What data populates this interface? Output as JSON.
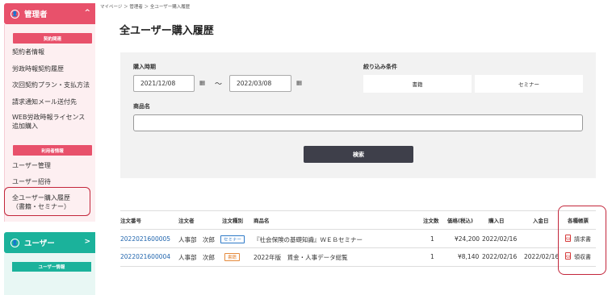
{
  "sidebar": {
    "admin": {
      "title": "管理者",
      "icon": "person-circle-icon",
      "chevron": "^",
      "categories": {
        "contract": "契約関連",
        "user_info": "利用者情報"
      },
      "contract_items": [
        "契約者情報",
        "労政時報契約履歴",
        "次回契約プラン・支払方法",
        "請求通知メール送付先",
        "WEB労政時報ライセンス",
        "追加購入"
      ],
      "user_items": [
        "ユーザー管理",
        "ユーザー招待"
      ],
      "active_item_line1": "全ユーザー購入履歴",
      "active_item_line2": "（書籍・セミナー）",
      "accent_color": "#e8516b"
    },
    "user": {
      "title": "ユーザー",
      "icon": "person-circle-icon",
      "chevron": ">",
      "category": "ユーザー情報",
      "accent_color": "#1bb29b"
    }
  },
  "breadcrumb": "マイページ ＞ 管理者 ＞ 全ユーザー購入履歴",
  "page_title": "全ユーザー購入履歴",
  "search": {
    "period_label": "購入時期",
    "date_from": "2021/12/08",
    "date_to": "2022/03/08",
    "tilde": "〜",
    "filter_label": "絞り込み条件",
    "filter_book": "書籍",
    "filter_seminar": "セミナー",
    "product_label": "商品名",
    "product_value": "",
    "submit": "検索"
  },
  "table": {
    "headers": [
      "注文番号",
      "注文者",
      "注文種別",
      "商品名",
      "注文数",
      "価格(税込)",
      "購入日",
      "入金日",
      "各種帳票"
    ],
    "rows": [
      {
        "order_no": "2022021600005",
        "orderer": "人事部　次郎",
        "type": "セミナー",
        "product": "『社会保険の基礎知識』ＷＥＢセミナー",
        "qty": "1",
        "price": "¥24,200",
        "purchase_date": "2022/02/16",
        "payment_date": "",
        "doc": "請求書"
      },
      {
        "order_no": "2022021600004",
        "orderer": "人事部　次郎",
        "type": "書籍",
        "product": "2022年版　賃金・人事データ総覧",
        "qty": "1",
        "price": "¥8,140",
        "purchase_date": "2022/02/16",
        "payment_date": "2022/02/16",
        "doc": "領収書"
      }
    ]
  }
}
